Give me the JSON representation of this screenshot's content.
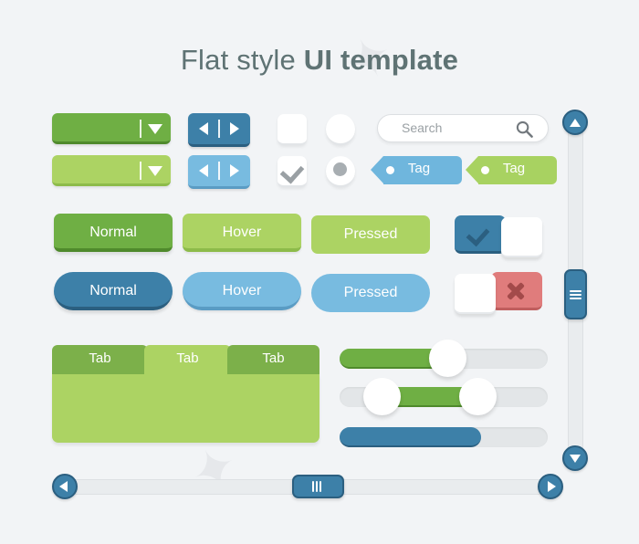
{
  "page": {
    "title_thin": "Flat style ",
    "title_bold": "UI template",
    "background_color": "#f2f4f6",
    "title_color": "#5f7374"
  },
  "palette": {
    "green_dark": "#6faf44",
    "green_dark_shadow": "#4f8a2c",
    "green_light": "#acd363",
    "green_light_shadow": "#8dbb4a",
    "green_tab": "#7cb04a",
    "blue_dark": "#3d80a8",
    "blue_dark_shadow": "#2b5f80",
    "blue_light": "#78bbe0",
    "blue_light_shadow": "#5a9cc4",
    "tag_blue": "#6fb6dd",
    "tag_green": "#a8d261",
    "red": "#e07c7c",
    "red_shadow": "#c05e5e",
    "track_gray": "#e3e6e8",
    "text_gray": "#9aa0a4",
    "white": "#ffffff"
  },
  "controls": {
    "selects": [
      {
        "name": "dropdown-normal",
        "state": "normal",
        "icon": "triangle-down-icon"
      },
      {
        "name": "dropdown-hover",
        "state": "hover",
        "icon": "triangle-down-icon"
      }
    ],
    "steppers": [
      {
        "name": "stepper-normal",
        "state": "normal",
        "icon_left": "triangle-left-icon",
        "icon_right": "triangle-right-icon"
      },
      {
        "name": "stepper-hover",
        "state": "hover",
        "icon_left": "triangle-left-icon",
        "icon_right": "triangle-right-icon"
      }
    ],
    "checkboxes": [
      {
        "name": "checkbox-unchecked",
        "checked": false
      },
      {
        "name": "checkbox-checked",
        "checked": true,
        "icon": "check-icon"
      }
    ],
    "radios": [
      {
        "name": "radio-unselected",
        "selected": false
      },
      {
        "name": "radio-selected",
        "selected": true
      }
    ]
  },
  "search": {
    "placeholder": "Search",
    "value": "",
    "icon": "search-icon"
  },
  "tags": [
    {
      "label": "Tag",
      "color": "blue"
    },
    {
      "label": "Tag",
      "color": "green"
    }
  ],
  "buttons": {
    "green_row": [
      {
        "label": "Normal",
        "state": "normal"
      },
      {
        "label": "Hover",
        "state": "hover"
      },
      {
        "label": "Pressed",
        "state": "pressed"
      }
    ],
    "blue_row": [
      {
        "label": "Normal",
        "state": "normal"
      },
      {
        "label": "Hover",
        "state": "hover"
      },
      {
        "label": "Pressed",
        "state": "pressed"
      }
    ]
  },
  "toggles": [
    {
      "name": "toggle-on",
      "state": "on",
      "icon": "check-icon",
      "color": "#3d80a8"
    },
    {
      "name": "toggle-off",
      "state": "off",
      "icon": "close-icon",
      "color": "#e07c7c"
    }
  ],
  "tabs": {
    "items": [
      {
        "label": "Tab",
        "active": false
      },
      {
        "label": "Tab",
        "active": true
      },
      {
        "label": "Tab",
        "active": false
      }
    ],
    "panel_content": ""
  },
  "sliders": [
    {
      "name": "slider-single",
      "type": "single",
      "value_pct": 52,
      "color": "green",
      "handles": 1
    },
    {
      "name": "slider-range",
      "type": "range",
      "start_pct": 20,
      "end_pct": 66,
      "color": "green",
      "handles": 2
    },
    {
      "name": "progress-bar",
      "type": "progress",
      "value_pct": 68,
      "color": "blue",
      "handles": 0
    }
  ],
  "scrollbars": {
    "vertical": {
      "name": "vertical-scrollbar",
      "up_icon": "triangle-up-icon",
      "down_icon": "triangle-down-icon",
      "thumb_position_pct": 44,
      "grip": "grip-lines-horizontal-icon"
    },
    "horizontal": {
      "name": "horizontal-scrollbar",
      "left_icon": "triangle-left-icon",
      "right_icon": "triangle-right-icon",
      "thumb_position_pct": 47,
      "grip": "grip-lines-vertical-icon"
    }
  }
}
